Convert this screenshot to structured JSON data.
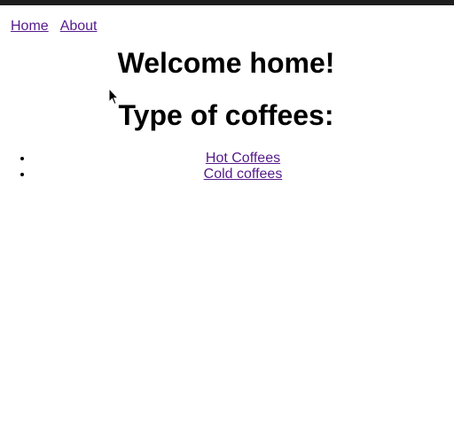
{
  "nav": {
    "home_label": "Home",
    "about_label": "About"
  },
  "main": {
    "welcome_heading": "Welcome home!",
    "types_heading": "Type of coffees:",
    "coffee_links": [
      "Hot Coffees",
      "Cold coffees"
    ]
  },
  "colors": {
    "link": "#551a8b",
    "top_bar": "#1e1e1e"
  },
  "icons": {
    "pointer": "mouse-pointer-icon"
  }
}
